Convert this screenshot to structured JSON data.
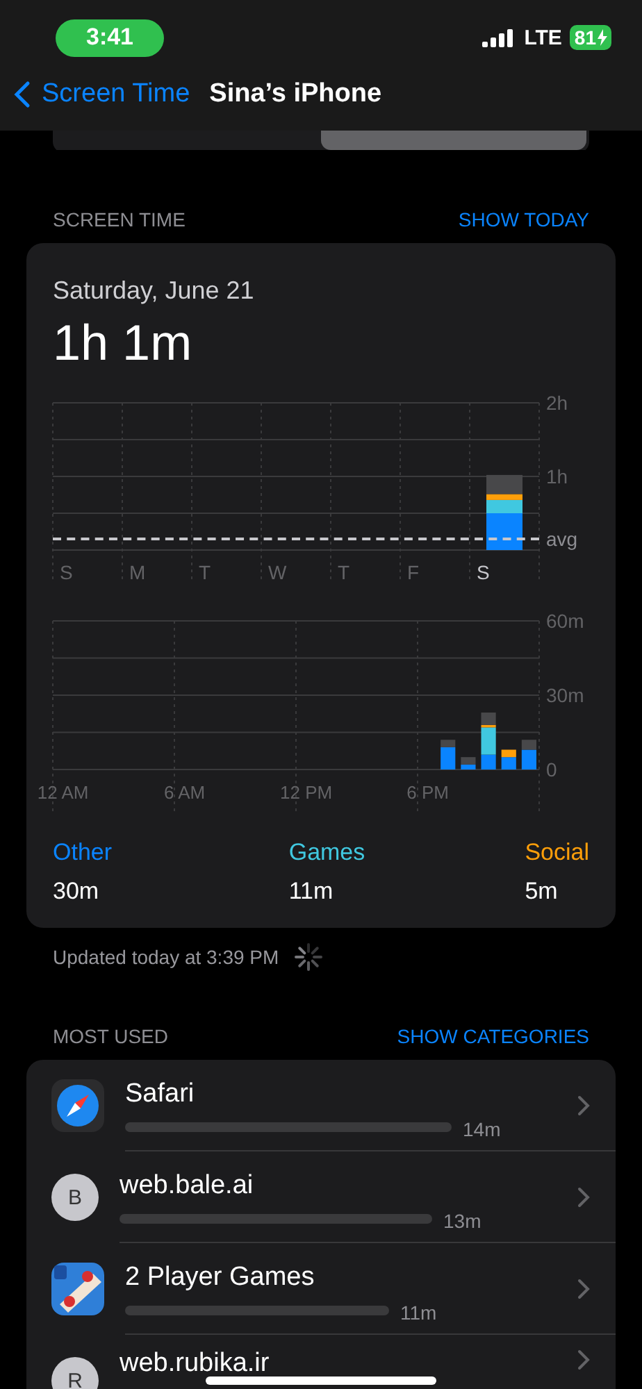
{
  "status_bar": {
    "time": "3:41",
    "network": "LTE",
    "battery": "81",
    "charging": true
  },
  "nav": {
    "back_label": "Screen Time",
    "title": "Sina’s iPhone"
  },
  "segments": [
    {
      "selected": false
    },
    {
      "selected": true
    }
  ],
  "screen_time": {
    "header": "SCREEN TIME",
    "action": "SHOW TODAY",
    "date": "Saturday, June 21",
    "total": "1h 1m",
    "weekly_chart": {
      "average_label": "avg",
      "chart_data": {
        "type": "bar",
        "stacked": true,
        "categories": [
          "S",
          "M",
          "T",
          "W",
          "T",
          "F",
          "S"
        ],
        "series": [
          {
            "color": "#0a84ff",
            "values": [
              null,
              null,
              null,
              null,
              null,
              null,
              0.5
            ]
          },
          {
            "color": "#40c8e0",
            "values": [
              null,
              null,
              null,
              null,
              null,
              null,
              0.18
            ]
          },
          {
            "color": "#ff9f0a",
            "values": [
              null,
              null,
              null,
              null,
              null,
              null,
              0.08
            ]
          },
          {
            "color": "#48484a",
            "values": [
              null,
              null,
              null,
              null,
              null,
              null,
              0.26
            ]
          }
        ],
        "ylim": [
          0,
          2
        ],
        "yticks": [
          {
            "value": 1,
            "label": "1h"
          },
          {
            "value": 2,
            "label": "2h"
          }
        ]
      }
    },
    "hourly_chart": {
      "chart_data": {
        "type": "bar",
        "stacked": true,
        "categories": [
          "12 AM",
          null,
          null,
          null,
          null,
          null,
          "6 AM",
          null,
          null,
          null,
          null,
          null,
          "12 PM",
          null,
          null,
          null,
          null,
          null,
          "6 PM",
          null,
          null,
          null,
          null,
          null
        ],
        "series": [
          {
            "color": "#0a84ff",
            "values": [
              null,
              null,
              null,
              null,
              null,
              null,
              null,
              null,
              null,
              null,
              null,
              null,
              null,
              null,
              null,
              null,
              null,
              null,
              null,
              9,
              2,
              6,
              5,
              8
            ]
          },
          {
            "color": "#40c8e0",
            "values": [
              null,
              null,
              null,
              null,
              null,
              null,
              null,
              null,
              null,
              null,
              null,
              null,
              null,
              null,
              null,
              null,
              null,
              null,
              null,
              0,
              0,
              11,
              0,
              0
            ]
          },
          {
            "color": "#ff9f0a",
            "values": [
              null,
              null,
              null,
              null,
              null,
              null,
              null,
              null,
              null,
              null,
              null,
              null,
              null,
              null,
              null,
              null,
              null,
              null,
              null,
              0,
              0,
              1,
              3,
              0
            ]
          },
          {
            "color": "#48484a",
            "values": [
              null,
              null,
              null,
              null,
              null,
              null,
              null,
              null,
              null,
              null,
              null,
              null,
              null,
              null,
              null,
              null,
              null,
              null,
              null,
              3,
              3,
              5,
              0,
              4
            ]
          }
        ],
        "ylim": [
          0,
          60
        ],
        "yticks": [
          {
            "value": 0,
            "label": "0"
          },
          {
            "value": 30,
            "label": "30m"
          },
          {
            "value": 60,
            "label": "60m"
          }
        ]
      }
    },
    "legend": [
      {
        "name": "Other",
        "value": "30m",
        "color": "#0a84ff"
      },
      {
        "name": "Games",
        "value": "11m",
        "color": "#40c8e0"
      },
      {
        "name": "Social",
        "value": "5m",
        "color": "#ff9f0a"
      }
    ]
  },
  "updated": "Updated today at 3:39 PM",
  "most_used": {
    "header": "MOST USED",
    "action": "SHOW CATEGORIES",
    "apps": [
      {
        "kind": "safari",
        "name": "Safari",
        "time": "14m"
      },
      {
        "kind": "letter",
        "initial": "B",
        "name": "web.bale.ai",
        "time": "13m"
      },
      {
        "kind": "game",
        "name": "2 Player Games",
        "time": "11m"
      },
      {
        "kind": "letter",
        "initial": "R",
        "name": "web.rubika.ir"
      }
    ]
  }
}
